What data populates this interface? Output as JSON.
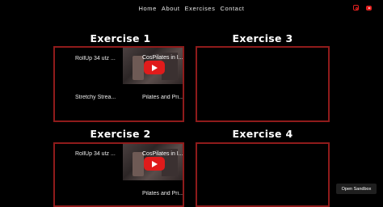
{
  "nav": {
    "items": [
      "Home",
      "About",
      "Exercises",
      "Contact"
    ]
  },
  "socials": {
    "instagram_icon": "instagram-icon",
    "youtube_icon": "youtube-icon",
    "accent": "#e0201f"
  },
  "exercises": [
    {
      "title": "Exercise 1",
      "left_top": "RollUp 34 utz ...",
      "right_top": "CosPilates in I...",
      "left_bottom": "Stretchy Strea...",
      "right_bottom": "Pilates and Pri..."
    },
    {
      "title": "Exercise 3"
    },
    {
      "title": "Exercise 2",
      "left_top": "RollUp 34 utz ...",
      "right_top": "CosPilates in I...",
      "right_bottom": "Pilates and Pri..."
    },
    {
      "title": "Exercise 4"
    }
  ],
  "sandbox_button": "Open Sandbox",
  "colors": {
    "background": "#000000",
    "panel_border": "#8f1b1b",
    "play_button": "#e01b1b"
  }
}
